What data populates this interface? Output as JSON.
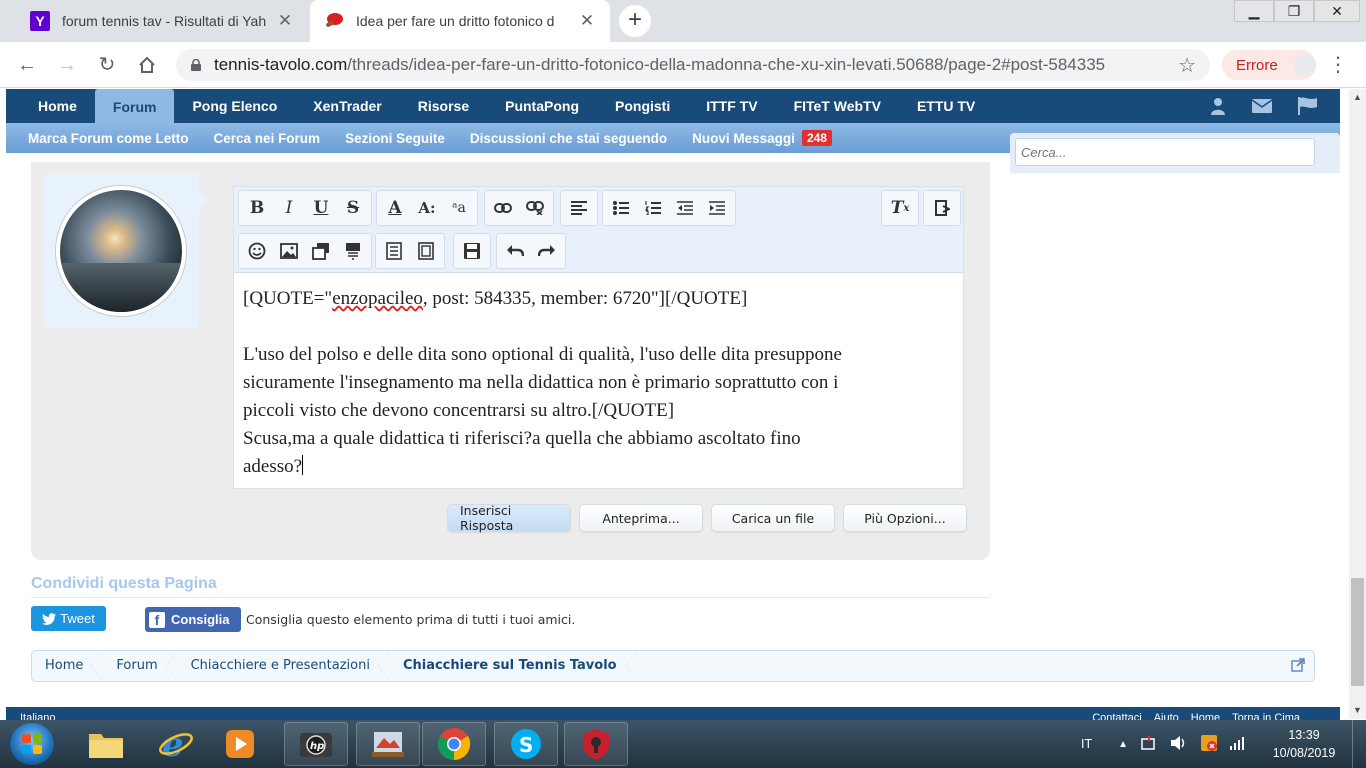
{
  "browser": {
    "tabs": [
      {
        "title": "forum tennis tav - Risultati di Yah",
        "favicon": "yahoo-icon",
        "active": false
      },
      {
        "title": "Idea per fare un dritto fotonico d",
        "favicon": "ping-pong-paddle-icon",
        "active": true
      }
    ],
    "url_domain": "tennis-tavolo.com",
    "url_path": "/threads/idea-per-fare-un-dritto-fotonico-della-madonna-che-xu-xin-levati.50688/page-2#post-584335",
    "profile_status": "Errore"
  },
  "forum": {
    "nav_tabs": [
      "Home",
      "Forum",
      "Pong Elenco",
      "XenTrader",
      "Risorse",
      "PuntaPong",
      "Pongisti",
      "ITTF TV",
      "FITeT WebTV",
      "ETTU TV"
    ],
    "selected_tab": "Forum",
    "subnav": [
      "Marca Forum come Letto",
      "Cerca nei Forum",
      "Sezioni Seguite",
      "Discussioni che stai seguendo",
      "Nuovi Messaggi"
    ],
    "new_messages_count": "248",
    "search_placeholder": "Cerca...",
    "colors": {
      "nav_dark": "#194b7a",
      "nav_light": "#8fb9e5",
      "badge": "#e03030"
    }
  },
  "editor": {
    "lines": [
      "[QUOTE=\"",
      "enzopacileo",
      ", post: 584335, member: 6720\"][/QUOTE]",
      "",
      "L'uso del polso e delle dita sono optional di qualità, l'uso delle dita presuppone",
      "sicuramente l'insegnamento ma nella didattica non è primario soprattutto con i",
      "piccoli visto che devono concentrarsi su altro.[/QUOTE]",
      "Scusa,ma a quale didattica ti riferisci?a quella che abbiamo ascoltato fino",
      "adesso?"
    ],
    "buttons": {
      "submit": "Inserisci Risposta",
      "preview": "Anteprima...",
      "upload": "Carica un file",
      "more": "Più Opzioni..."
    }
  },
  "share": {
    "title": "Condividi questa Pagina",
    "tweet": "Tweet",
    "facebook": "Consiglia",
    "facebook_text": "Consiglia questo elemento prima di tutti i tuoi amici."
  },
  "breadcrumb": [
    "Home",
    "Forum",
    "Chiacchiere e Presentazioni",
    "Chiacchiere sul Tennis Tavolo"
  ],
  "footer": {
    "language": "Italiano",
    "links": [
      "Contattaci",
      "Aiuto",
      "Home",
      "Torna in Cima"
    ]
  },
  "taskbar": {
    "language": "IT",
    "time": "13:39",
    "date": "10/08/2019"
  }
}
